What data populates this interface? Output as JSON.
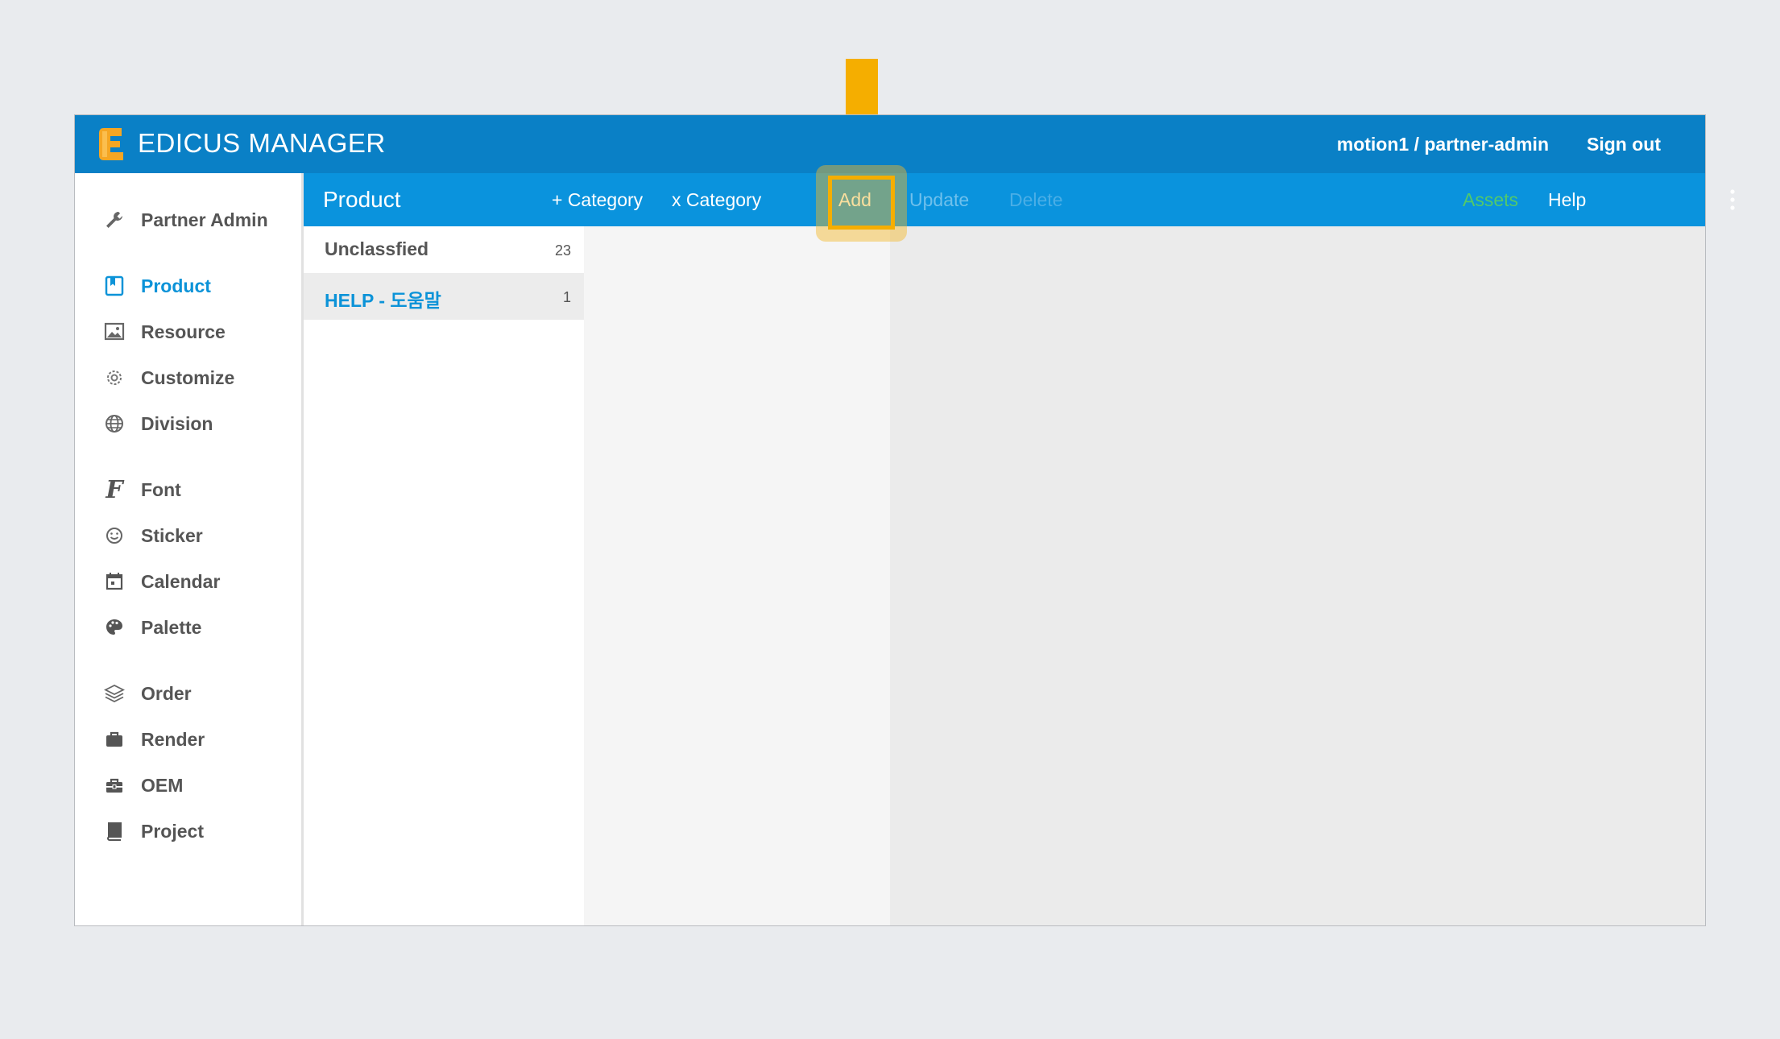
{
  "app": {
    "brand": "EDICUS MANAGER",
    "user": "motion1 / partner-admin",
    "sign_out": "Sign out"
  },
  "sidebar": {
    "items": [
      {
        "label": "Partner Admin",
        "icon": "wrench-icon"
      },
      {
        "label": "Product",
        "icon": "bookmark-book-icon",
        "active": true
      },
      {
        "label": "Resource",
        "icon": "image-icon"
      },
      {
        "label": "Customize",
        "icon": "gear-icon"
      },
      {
        "label": "Division",
        "icon": "globe-icon"
      },
      {
        "label": "Font",
        "icon": "font-icon"
      },
      {
        "label": "Sticker",
        "icon": "smiley-icon"
      },
      {
        "label": "Calendar",
        "icon": "calendar-icon"
      },
      {
        "label": "Palette",
        "icon": "palette-icon"
      },
      {
        "label": "Order",
        "icon": "layers-icon"
      },
      {
        "label": "Render",
        "icon": "briefcase-icon"
      },
      {
        "label": "OEM",
        "icon": "toolbox-icon"
      },
      {
        "label": "Project",
        "icon": "book-icon"
      }
    ]
  },
  "toolbar": {
    "title": "Product",
    "add_category": "+ Category",
    "remove_category": "x Category",
    "add": "Add",
    "update": "Update",
    "delete": "Delete",
    "assets": "Assets",
    "help": "Help",
    "more_icon": "vertical-dots-icon"
  },
  "categories": [
    {
      "name": "Unclassfied",
      "count": "23"
    },
    {
      "name": "HELP - 도움말",
      "count": "1",
      "selected": true
    }
  ],
  "colors": {
    "appbar": "#0a80c6",
    "toolbar": "#0a93dd",
    "active": "#0c93d8",
    "highlight": "#f5ae00",
    "assets": "#52c96a"
  }
}
